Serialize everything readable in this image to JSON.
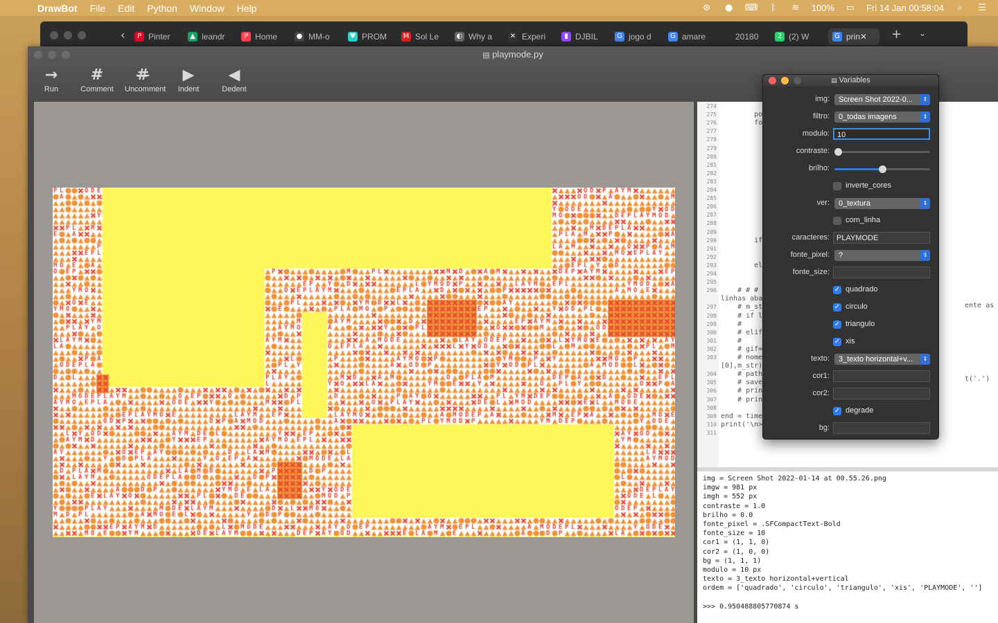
{
  "menubar": {
    "app": "DrawBot",
    "items": [
      "File",
      "Edit",
      "Python",
      "Window",
      "Help"
    ],
    "battery": "100%",
    "clock": "Fri 14 Jan  00:58:04"
  },
  "browser_tabs": [
    {
      "label": "Pinter",
      "color": "#e60023",
      "glyph": "P"
    },
    {
      "label": "leandr",
      "color": "#1aa260",
      "glyph": "▲"
    },
    {
      "label": "Home",
      "color": "#ff424d",
      "glyph": "P"
    },
    {
      "label": "MM-o",
      "color": "#444444",
      "glyph": "●"
    },
    {
      "label": "PROM",
      "color": "#2ad4c8",
      "glyph": "♥"
    },
    {
      "label": "Sol Le",
      "color": "#e02020",
      "glyph": "M"
    },
    {
      "label": "Why a",
      "color": "#666666",
      "glyph": "◐"
    },
    {
      "label": "Experi",
      "color": "#333333",
      "glyph": "✕"
    },
    {
      "label": "DJBIL",
      "color": "#9146ff",
      "glyph": "▮"
    },
    {
      "label": "jogo d",
      "color": "#4285f4",
      "glyph": "G"
    },
    {
      "label": "amare",
      "color": "#4285f4",
      "glyph": "G"
    },
    {
      "label": "20180",
      "color": "#2c2c2e",
      "glyph": ""
    },
    {
      "label": "(2) W",
      "color": "#25d366",
      "glyph": "2"
    },
    {
      "label": "prin",
      "color": "#4285f4",
      "glyph": "G"
    }
  ],
  "window": {
    "title": "playmode.py"
  },
  "toolbar": [
    {
      "label": "Run",
      "icon": "→"
    },
    {
      "label": "Comment",
      "icon": "#"
    },
    {
      "label": "Uncomment",
      "icon": "#"
    },
    {
      "label": "Indent",
      "icon": "▶"
    },
    {
      "label": "Dedent",
      "icon": "◀"
    }
  ],
  "artwork": {
    "text": "PLAYMODE",
    "colors": {
      "yellow": "#fff75a",
      "red": "#e8452b",
      "orange": "#f0923a",
      "white": "#ffffff",
      "accent": "#2d7cf0"
    }
  },
  "editor": {
    "lines": [
      {
        "n": "274",
        "code": ""
      },
      {
        "n": "275",
        "code": "        po"
      },
      {
        "n": "276",
        "code": "        fo"
      },
      {
        "n": "277",
        "code": ""
      },
      {
        "n": "278",
        "code": ""
      },
      {
        "n": "279",
        "code": ""
      },
      {
        "n": "280",
        "code": ""
      },
      {
        "n": "281",
        "code": ""
      },
      {
        "n": "282",
        "code": ""
      },
      {
        "n": "283",
        "code": ""
      },
      {
        "n": "284",
        "code": ""
      },
      {
        "n": "285",
        "code": ""
      },
      {
        "n": "286",
        "code": ""
      },
      {
        "n": "287",
        "code": ""
      },
      {
        "n": "288",
        "code": ""
      },
      {
        "n": "289",
        "code": ""
      },
      {
        "n": "290",
        "code": "        if"
      },
      {
        "n": "291",
        "code": ""
      },
      {
        "n": "292",
        "code": ""
      },
      {
        "n": "293",
        "code": "        el"
      },
      {
        "n": "294",
        "code": ""
      },
      {
        "n": "295",
        "code": ""
      },
      {
        "n": "296",
        "code": "    # # #"
      },
      {
        "n": "",
        "code": "linhas aba"
      },
      {
        "n": "297",
        "code": "    # m_st"
      },
      {
        "n": "298",
        "code": "    # if l"
      },
      {
        "n": "299",
        "code": "    #"
      },
      {
        "n": "300",
        "code": "    # elif"
      },
      {
        "n": "301",
        "code": "    #"
      },
      {
        "n": "302",
        "code": "    # gif="
      },
      {
        "n": "303",
        "code": "    # nome"
      },
      {
        "n": "",
        "code": "[0],m_str)"
      },
      {
        "n": "304",
        "code": "    # path"
      },
      {
        "n": "305",
        "code": "    # save"
      },
      {
        "n": "306",
        "code": "    # prin"
      },
      {
        "n": "307",
        "code": "    # prin"
      },
      {
        "n": "308",
        "code": ""
      },
      {
        "n": "309",
        "code": "end = time.time()"
      },
      {
        "n": "310",
        "code": "print('\\n>>>', end-start, 's')"
      },
      {
        "n": "311",
        "code": ""
      }
    ],
    "right_fragments": [
      ")",
      "ente as",
      "t('.')"
    ]
  },
  "console": {
    "output": "img = Screen Shot 2022-01-14 at 00.55.26.png\nimgw = 981 px\nimgh = 552 px\ncontraste = 1.0\nbrilho = 0.0\nfonte_pixel = .SFCompactText-Bold\nfonte_size = 10\ncor1 = (1, 1, 0)\ncor2 = (1, 0, 0)\nbg = (1, 1, 1)\nmodulo = 10 px\ntexto = 3_texto horizontal+vertical\nordem = ['quadrado', 'circulo', 'triangulo', 'xis', 'PLAYMODE', '']\n\n>>> 0.950488805770874 s"
  },
  "variables": {
    "title": "Variables",
    "img": {
      "label": "img:",
      "value": "Screen Shot 2022-0..."
    },
    "filtro": {
      "label": "filtro:",
      "value": "0_todas imagens"
    },
    "modulo": {
      "label": "modulo:",
      "value": "10"
    },
    "contraste": {
      "label": "contraste:",
      "fraction": 0.0
    },
    "brilho": {
      "label": "brilho:",
      "fraction": 0.5
    },
    "inverte_cores": {
      "label": "inverte_cores",
      "checked": false
    },
    "ver": {
      "label": "ver:",
      "value": "0_textura"
    },
    "com_linha": {
      "label": "com_linha",
      "checked": false
    },
    "caracteres": {
      "label": "caracteres:",
      "value": "PLAYMODE"
    },
    "fonte_pixel": {
      "label": "fonte_pixel:",
      "value": "?"
    },
    "fonte_size": {
      "label": "fonte_size:",
      "value": ""
    },
    "quadrado": {
      "label": "quadrado",
      "checked": true
    },
    "circulo": {
      "label": "circulo",
      "checked": true
    },
    "triangulo": {
      "label": "triangulo",
      "checked": true
    },
    "xis": {
      "label": "xis",
      "checked": true
    },
    "texto": {
      "label": "texto:",
      "value": "3_texto horizontal+v..."
    },
    "cor1": {
      "label": "cor1:",
      "value": ""
    },
    "cor2": {
      "label": "cor2:",
      "value": ""
    },
    "degrade": {
      "label": "degrade",
      "checked": true
    },
    "bg": {
      "label": "bg:",
      "value": ""
    }
  }
}
